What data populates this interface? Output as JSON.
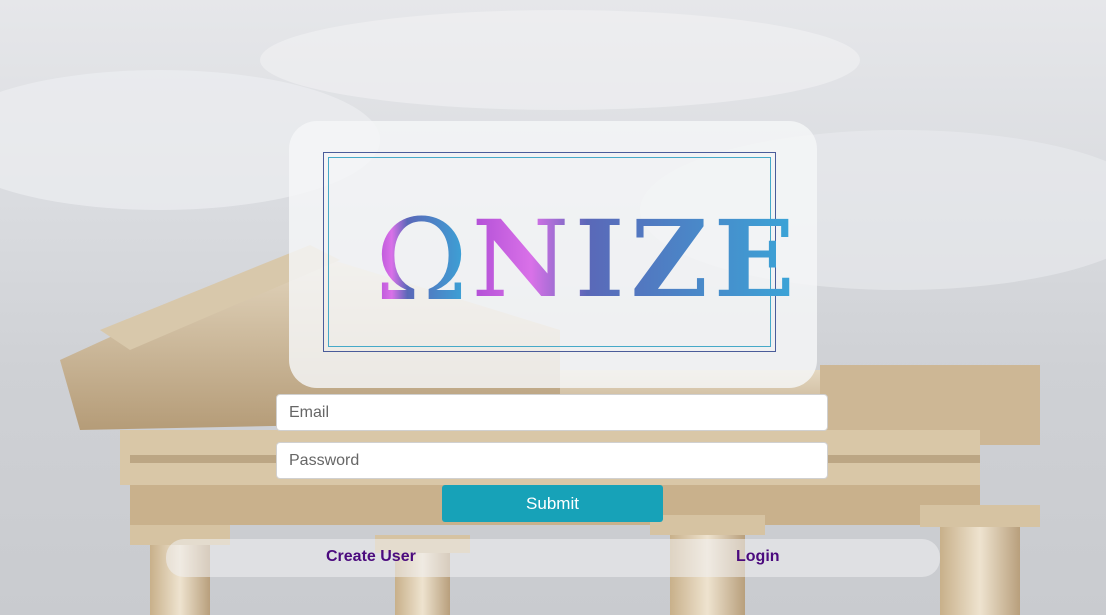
{
  "logo": {
    "omega": "Ω",
    "word": "NIZE"
  },
  "form": {
    "email_placeholder": "Email",
    "password_placeholder": "Password",
    "submit_label": "Submit"
  },
  "links": {
    "create_user": "Create User",
    "login": "Login"
  },
  "colors": {
    "submit_bg": "#17a2b8",
    "link_color": "#4b0a7e",
    "logo_gradient_start": "#b14fd6",
    "logo_gradient_end": "#3aa6d8",
    "frame_outer": "#4a5c9a",
    "frame_inner": "#46a9c8"
  }
}
